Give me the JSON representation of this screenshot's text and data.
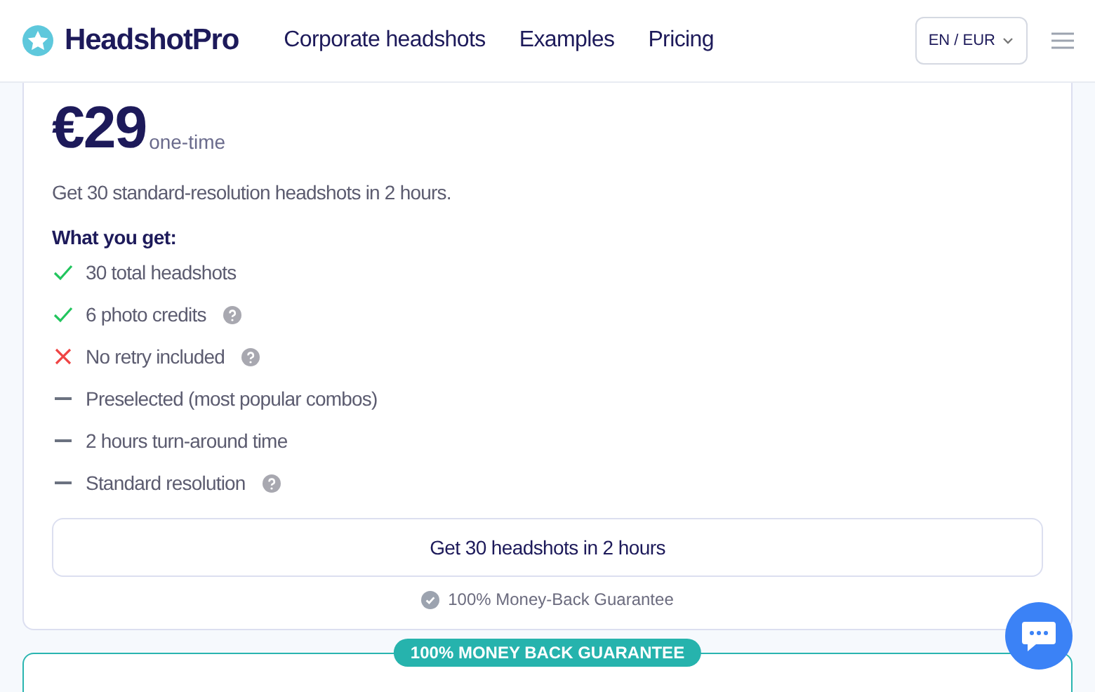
{
  "header": {
    "logo": "HeadshotPro",
    "nav": [
      "Corporate headshots",
      "Examples",
      "Pricing"
    ],
    "locale": "EN / EUR"
  },
  "plan": {
    "price": "€29",
    "period": "one-time",
    "description": "Get 30 standard-resolution headshots in 2 hours.",
    "features_title": "What you get:",
    "features": [
      {
        "kind": "check",
        "text": "30 total headshots",
        "help": false
      },
      {
        "kind": "check",
        "text": "6 photo credits",
        "help": true
      },
      {
        "kind": "cross",
        "text": "No retry included",
        "help": true
      },
      {
        "kind": "dash",
        "text": "Preselected (most popular combos)",
        "help": false
      },
      {
        "kind": "dash",
        "text": "2 hours turn-around time",
        "help": false
      },
      {
        "kind": "dash",
        "text": "Standard resolution",
        "help": true
      }
    ],
    "button": "Get 30 headshots in 2 hours",
    "guarantee": "100% Money-Back Guarantee"
  },
  "next_card": {
    "badge": "100% MONEY BACK GUARANTEE"
  }
}
